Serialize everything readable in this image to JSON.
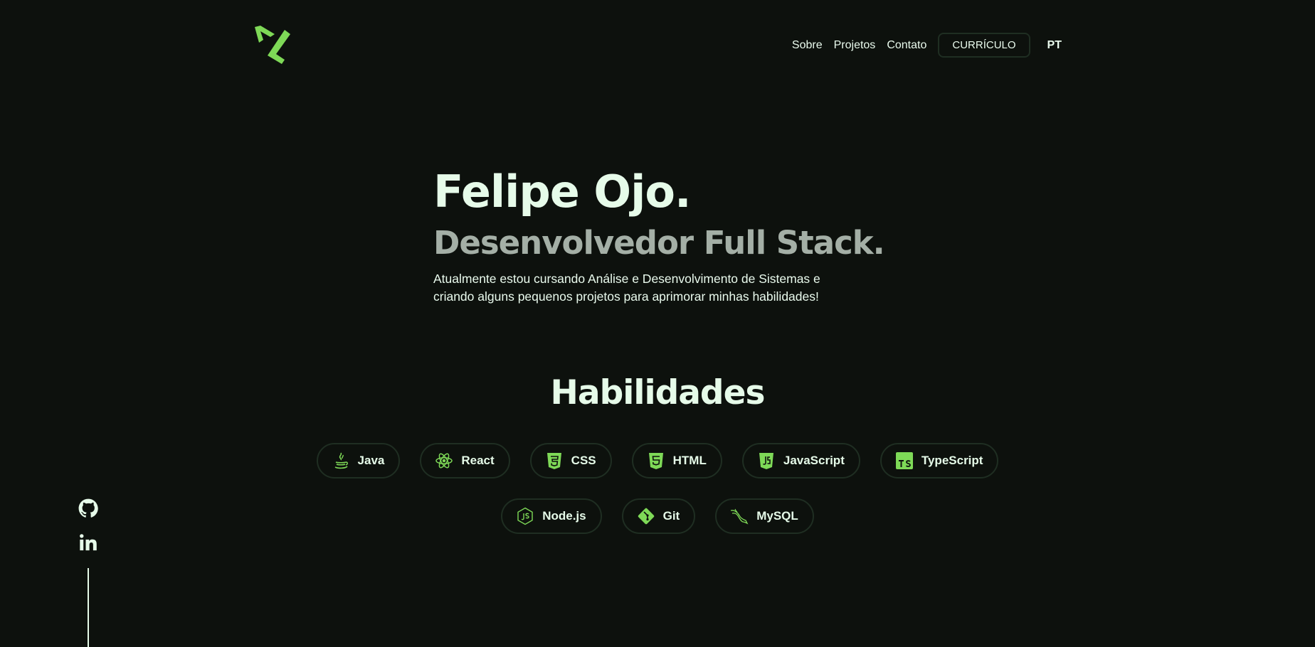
{
  "header": {
    "logo": "fo-logo",
    "nav": [
      {
        "label": "Sobre"
      },
      {
        "label": "Projetos"
      },
      {
        "label": "Contato"
      }
    ],
    "resume_label": "CURRÍCULO",
    "language": "PT"
  },
  "hero": {
    "name": "Felipe Ojo.",
    "role": "Desenvolvedor Full Stack.",
    "description": "Atualmente estou cursando Análise e Desenvolvimento de Sistemas e criando alguns pequenos projetos para aprimorar minhas habilidades!"
  },
  "skills": {
    "title": "Habilidades",
    "items": [
      {
        "label": "Java",
        "icon": "java-icon"
      },
      {
        "label": "React",
        "icon": "react-icon"
      },
      {
        "label": "CSS",
        "icon": "css3-icon"
      },
      {
        "label": "HTML",
        "icon": "html5-icon"
      },
      {
        "label": "JavaScript",
        "icon": "javascript-icon"
      },
      {
        "label": "TypeScript",
        "icon": "typescript-icon"
      },
      {
        "label": "Node.js",
        "icon": "nodejs-icon"
      },
      {
        "label": "Git",
        "icon": "git-icon"
      },
      {
        "label": "MySQL",
        "icon": "mysql-icon"
      }
    ]
  },
  "social": [
    {
      "icon": "github-icon"
    },
    {
      "icon": "linkedin-icon"
    }
  ],
  "colors": {
    "background": "#0d110d",
    "accent": "#7ed957",
    "text": "#e6fbe9",
    "muted": "#a4afa6",
    "border": "#1f2e22"
  }
}
